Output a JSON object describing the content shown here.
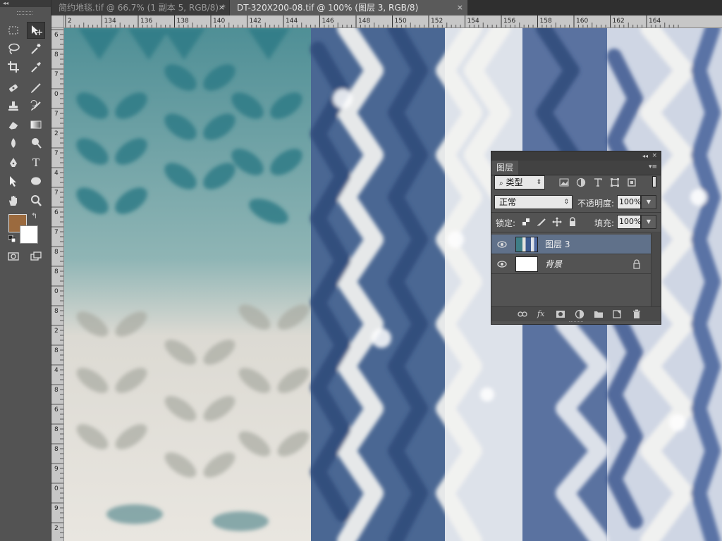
{
  "tabs": [
    {
      "title": "简约地毯.tif @ 66.7% (1 副本 5, RGB/8) *",
      "close": "×"
    },
    {
      "title": "DT-320X200-08.tif @ 100% (图层 3, RGB/8)",
      "close": "×"
    }
  ],
  "ruler": {
    "h_labels": [
      "2",
      "134",
      "136",
      "138",
      "140",
      "142",
      "144",
      "146",
      "148",
      "150",
      "152",
      "154",
      "156",
      "158",
      "160",
      "162",
      "164"
    ],
    "v_labels": [
      "6",
      "8",
      "7",
      "0",
      "7",
      "2",
      "7",
      "4",
      "7",
      "6",
      "7",
      "8",
      "8",
      "0",
      "8",
      "2",
      "8",
      "4",
      "8",
      "6",
      "8",
      "8",
      "9",
      "0",
      "9",
      "2"
    ]
  },
  "toolbox": {
    "collapse": "◂◂",
    "foreground_color": "#9b6a3e",
    "background_color": "#ffffff",
    "swap": "↰",
    "tools": [
      {
        "name": "rectangular-marquee-icon"
      },
      {
        "name": "move-icon"
      },
      {
        "name": "lasso-icon"
      },
      {
        "name": "magic-wand-icon"
      },
      {
        "name": "crop-icon"
      },
      {
        "name": "eyedropper-icon"
      },
      {
        "name": "spot-healing-icon"
      },
      {
        "name": "brush-icon"
      },
      {
        "name": "clone-stamp-icon"
      },
      {
        "name": "history-brush-icon"
      },
      {
        "name": "eraser-icon"
      },
      {
        "name": "gradient-icon"
      },
      {
        "name": "blur-icon"
      },
      {
        "name": "dodge-icon"
      },
      {
        "name": "pen-icon"
      },
      {
        "name": "type-icon",
        "glyph": "T"
      },
      {
        "name": "path-selection-icon"
      },
      {
        "name": "ellipse-icon"
      },
      {
        "name": "hand-icon"
      },
      {
        "name": "zoom-icon"
      },
      {
        "name": "quick-mask-icon"
      },
      {
        "name": "screen-mode-icon"
      }
    ]
  },
  "layers_panel": {
    "collapse": "◂◂",
    "close": "×",
    "tab": "图层",
    "menu": "▾≡",
    "kind": "类型",
    "blend_mode": "正常",
    "opacity_label": "不透明度:",
    "opacity": "100%",
    "lock_label": "锁定:",
    "fill_label": "填充:",
    "fill": "100%",
    "layers": [
      {
        "name": "图层 3",
        "selected": true,
        "visible": true
      },
      {
        "name": "背景",
        "selected": false,
        "visible": true,
        "locked": true
      }
    ],
    "footer": {
      "fx": "fx"
    }
  }
}
